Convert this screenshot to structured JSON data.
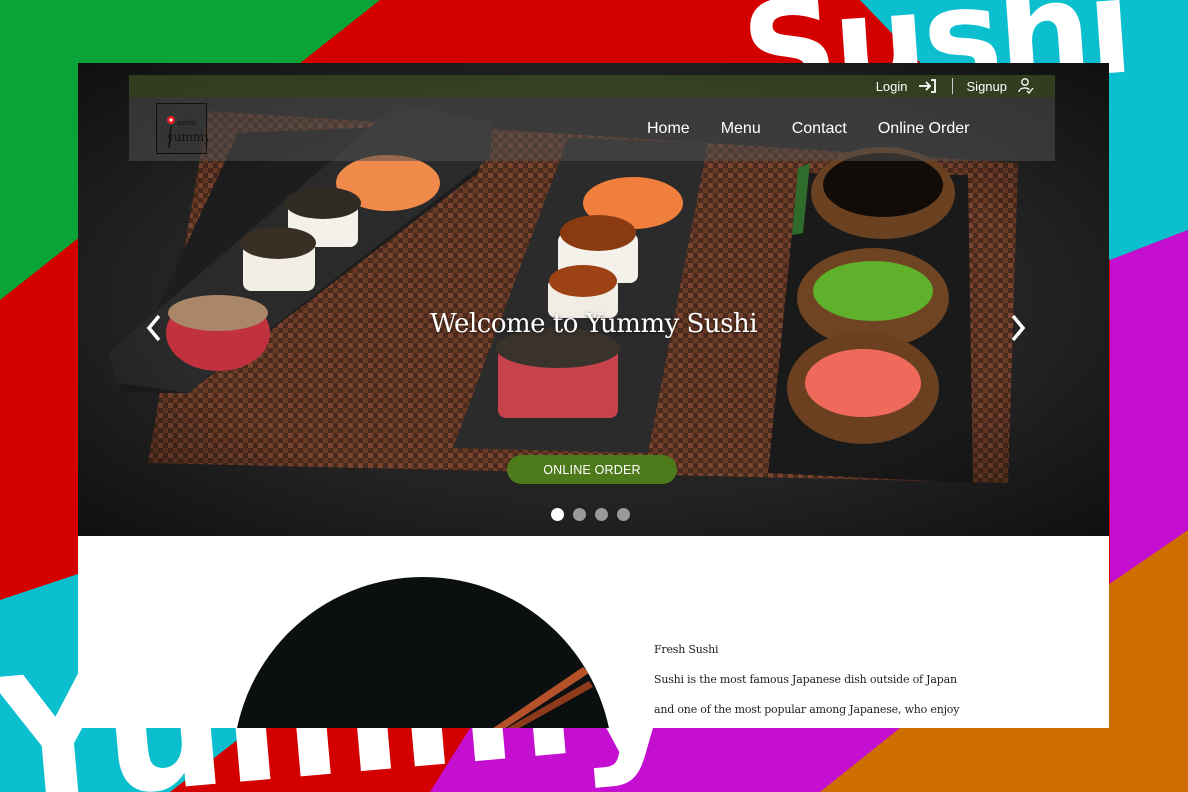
{
  "backdrop": {
    "word_top": "Sushi",
    "word_bottom": "Yummy",
    "colors": {
      "red": "#d40000",
      "green": "#0aa337",
      "cyan": "#0cbfcf",
      "magenta": "#c40fd0",
      "orange": "#cf6e00"
    }
  },
  "site": {
    "logo": {
      "small_text": "sushi",
      "large_text": "yummy"
    },
    "top_links": {
      "login": "Login",
      "signup": "Signup"
    },
    "nav": [
      "Home",
      "Menu",
      "Contact",
      "Online Order"
    ],
    "hero": {
      "headline": "Welcome to Yummy Sushi",
      "cta_label": "ONLINE ORDER",
      "slides_total": 4,
      "active_slide": 1
    },
    "intro": {
      "heading": "Fresh Sushi",
      "line1": "Sushi is the most famous Japanese dish outside of Japan",
      "line2": "and one of the most popular among Japanese, who enjoy"
    },
    "colors": {
      "accent_green": "#4d7a1a",
      "topbar": "#3c4b23"
    }
  }
}
